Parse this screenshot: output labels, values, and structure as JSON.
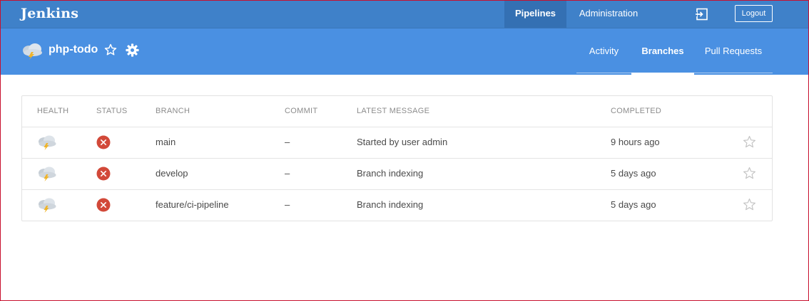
{
  "app": {
    "brand": "Jenkins",
    "nav": {
      "pipelines": "Pipelines",
      "administration": "Administration",
      "logout": "Logout"
    }
  },
  "job": {
    "name": "php-todo",
    "weather_icon": "cloud-storm-icon",
    "tabs": [
      "Activity",
      "Branches",
      "Pull Requests"
    ],
    "active_tab": "Branches"
  },
  "table": {
    "headers": [
      "HEALTH",
      "STATUS",
      "BRANCH",
      "COMMIT",
      "LATEST MESSAGE",
      "COMPLETED"
    ],
    "rows": [
      {
        "health": "cloud-storm-icon",
        "status": "failed",
        "branch": "main",
        "commit": "–",
        "message": "Started by user admin",
        "completed": "9 hours ago"
      },
      {
        "health": "cloud-storm-icon",
        "status": "failed",
        "branch": "develop",
        "commit": "–",
        "message": "Branch indexing",
        "completed": "5 days ago"
      },
      {
        "health": "cloud-storm-icon",
        "status": "failed",
        "branch": "feature/ci-pipeline",
        "commit": "–",
        "message": "Branch indexing",
        "completed": "5 days ago"
      }
    ]
  },
  "colors": {
    "topbar": "#3f81c9",
    "subbar": "#4a90e2",
    "status_failed": "#d24939",
    "lightning": "#f0b429"
  }
}
